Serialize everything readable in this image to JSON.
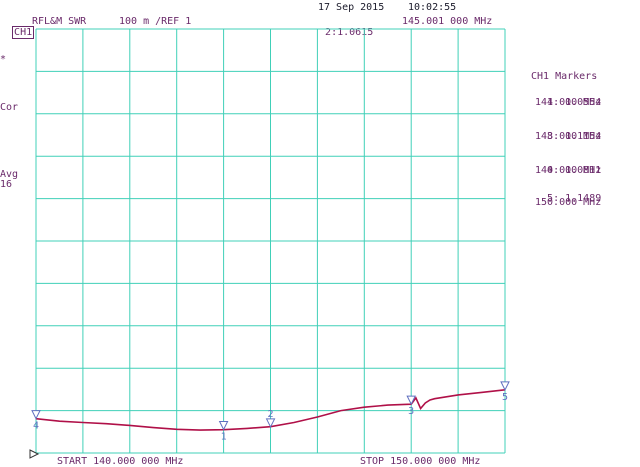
{
  "header": {
    "channel": "CH1",
    "measurement": "RFL&M SWR",
    "scale": "100 m /REF 1",
    "date": "17 Sep 2015",
    "time": "10:02:55",
    "active_marker": {
      "label": "2:",
      "value": "1.0615",
      "frequency": "145.001 000 MHz"
    }
  },
  "left_annotations": {
    "star": "*",
    "cor": "Cor",
    "avg": "Avg",
    "avg_count": "16"
  },
  "markers_panel": {
    "title": "CH1 Markers",
    "entries": [
      {
        "label": "1:",
        "value": "1.0554",
        "frequency": "144.000 MHz"
      },
      {
        "label": "3:",
        "value": "1.1154",
        "frequency": "148.000 MHz"
      },
      {
        "label": "4:",
        "value": "1.0811",
        "frequency": "140.000 MHz"
      },
      {
        "label": "5:",
        "value": "1.1489",
        "frequency": "150.000 MHz"
      }
    ]
  },
  "footer": {
    "start": "START 140.000 000 MHz",
    "stop": "STOP 150.000 000 MHz"
  },
  "colors": {
    "grid": "#40d0b8",
    "trace": "#b01048",
    "marker": "#6070c0",
    "text": "#6a2a6a"
  },
  "chart_data": {
    "type": "line",
    "title": "",
    "xlabel": "",
    "ylabel": "",
    "xlim": [
      140,
      150
    ],
    "ylim": [
      1.0,
      2.0
    ],
    "grid": true,
    "x_divisions": 10,
    "y_divisions": 10,
    "series": [
      {
        "x": [
          140.0,
          140.5,
          141.0,
          141.5,
          142.0,
          142.5,
          143.0,
          143.5,
          144.0,
          144.5,
          145.0,
          145.5,
          146.0,
          146.5,
          147.0,
          147.5,
          148.0,
          148.1,
          148.2,
          148.3,
          148.4,
          148.5,
          149.0,
          149.5,
          150.0
        ],
        "y": [
          1.081,
          1.075,
          1.072,
          1.069,
          1.065,
          1.06,
          1.056,
          1.054,
          1.055,
          1.058,
          1.062,
          1.072,
          1.085,
          1.1,
          1.108,
          1.113,
          1.115,
          1.13,
          1.105,
          1.118,
          1.125,
          1.128,
          1.137,
          1.143,
          1.149
        ]
      }
    ],
    "markers": [
      {
        "id": "1",
        "x": 144.0,
        "y": 1.0554,
        "label_pos": "below"
      },
      {
        "id": "2",
        "x": 145.001,
        "y": 1.0615,
        "label_pos": "above"
      },
      {
        "id": "3",
        "x": 148.0,
        "y": 1.1154,
        "label_pos": "below"
      },
      {
        "id": "4",
        "x": 140.0,
        "y": 1.0811,
        "label_pos": "below"
      },
      {
        "id": "5",
        "x": 150.0,
        "y": 1.1489,
        "label_pos": "below"
      }
    ]
  }
}
